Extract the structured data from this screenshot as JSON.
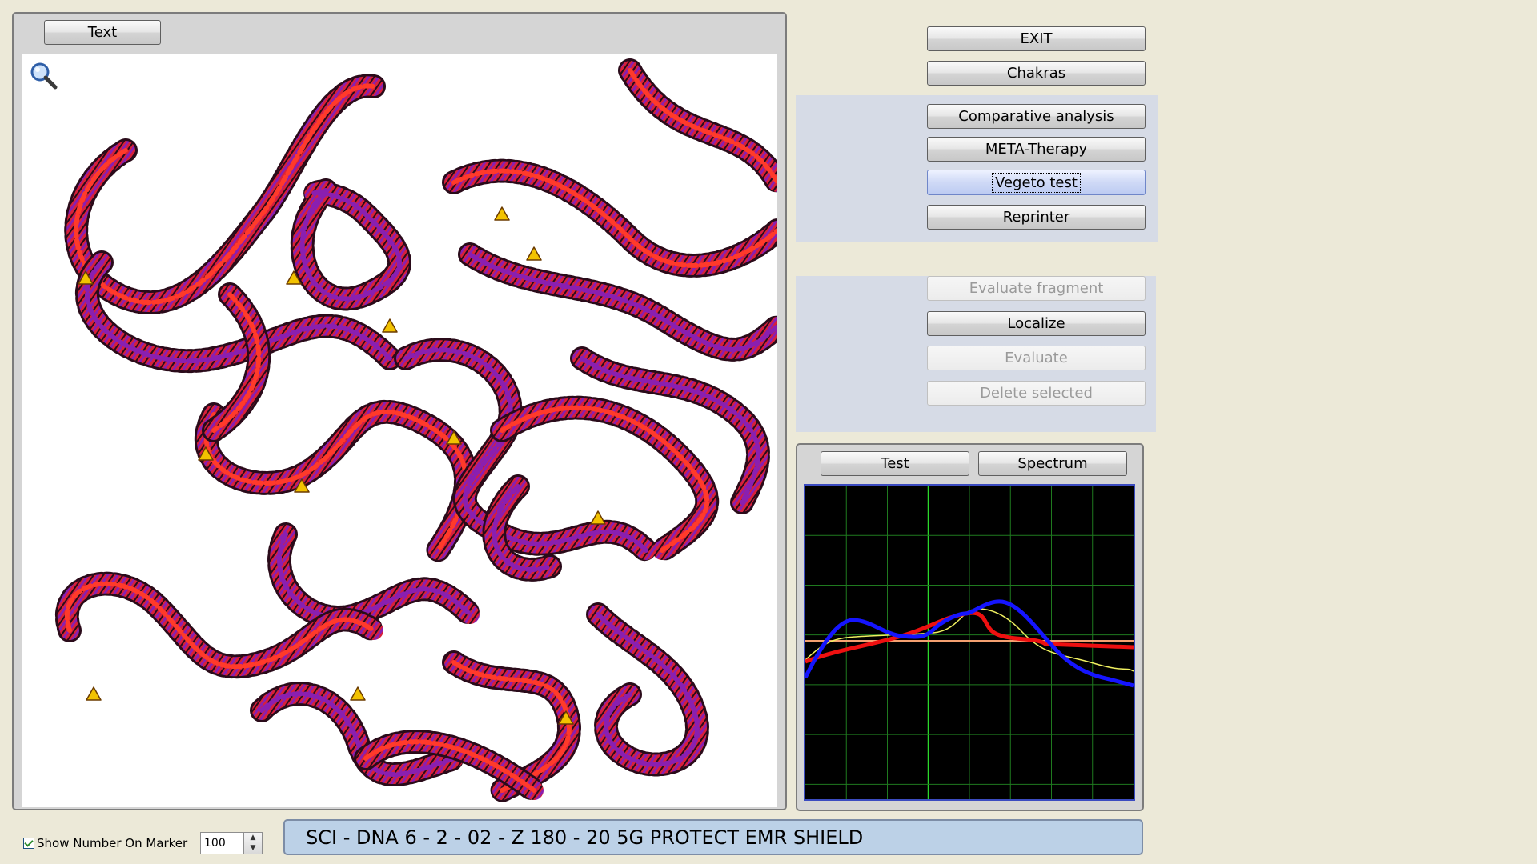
{
  "viewer": {
    "text_button": "Text",
    "magnifier_icon": "magnifier-icon",
    "image_subject": "dna-helix-strands",
    "strand_color": "#d8203a",
    "strand_accent": "#8a1fb0"
  },
  "menu": {
    "exit": "EXIT",
    "chakras": "Chakras",
    "comparative_analysis": "Comparative analysis",
    "meta_therapy": "META-Therapy",
    "vegeto_test": "Vegeto test",
    "reprinter": "Reprinter",
    "evaluate_fragment": "Evaluate fragment",
    "localize": "Localize",
    "evaluate": "Evaluate",
    "delete_selected": "Delete selected"
  },
  "graph": {
    "test_button": "Test",
    "spectrum_button": "Spectrum",
    "grid_color": "#1f7a1f",
    "center_line_color": "#2bd62b",
    "baseline_color": "#f4a070",
    "series_colors": {
      "blue": "#1515ff",
      "red": "#ee1010",
      "yellow": "#f0f060"
    }
  },
  "footer": {
    "show_number_label": "Show Number On Marker",
    "show_number_checked": true,
    "spin_value": "100",
    "status_text": "SCI - DNA 6 - 2 - 02 - Z 180 - 20  5G PROTECT EMR SHIELD"
  }
}
